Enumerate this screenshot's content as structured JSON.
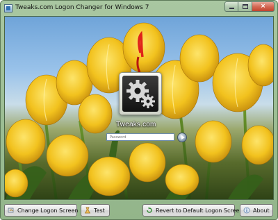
{
  "window": {
    "title": "Tweaks.com Logon Changer for Windows 7",
    "controls": {
      "minimize": "minimize",
      "maximize": "maximize",
      "close": "×"
    }
  },
  "preview": {
    "brand_text": "Tweaks.com",
    "password_placeholder": "Password",
    "go_icon": "arrow-right-icon",
    "logo_icon": "gears-icon"
  },
  "buttons": {
    "change_label": "Change Logon Screen",
    "test_label": "Test",
    "revert_label": "Revert to Default Logon Screen",
    "about_label": "About"
  },
  "colors": {
    "frame": "#9fc097",
    "tulip_yellow": "#f2c21e",
    "sky": "#8fbbe6",
    "stem_green": "#3c6b1d"
  }
}
